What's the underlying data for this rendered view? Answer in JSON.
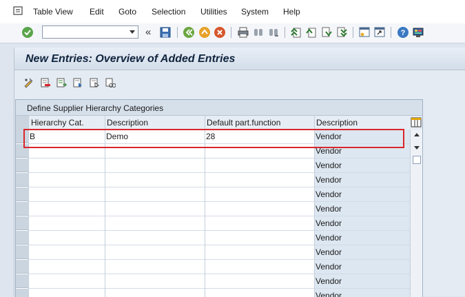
{
  "menu": {
    "items": [
      "Table View",
      "Edit",
      "Goto",
      "Selection",
      "Utilities",
      "System",
      "Help"
    ]
  },
  "toolbar": {
    "command_field": "",
    "icons": [
      "enter-icon",
      "back-chevron-icon",
      "save-icon",
      "back-icon",
      "exit-icon",
      "cancel-icon",
      "print-icon",
      "find-icon",
      "find-next-icon",
      "first-page-icon",
      "previous-page-icon",
      "next-page-icon",
      "last-page-icon",
      "create-session-icon",
      "shortcut-icon",
      "help-icon",
      "customize-layout-icon"
    ]
  },
  "screen": {
    "title": "New Entries: Overview of Added Entries"
  },
  "table": {
    "title": "Define Supplier Hierarchy Categories",
    "columns": [
      "Hierarchy Cat.",
      "Description",
      "Default part.function",
      "Description"
    ],
    "rows": [
      [
        "B",
        "Demo",
        "28",
        "Vendor"
      ],
      [
        "",
        "",
        "",
        "Vendor"
      ],
      [
        "",
        "",
        "",
        "Vendor"
      ],
      [
        "",
        "",
        "",
        "Vendor"
      ],
      [
        "",
        "",
        "",
        "Vendor"
      ],
      [
        "",
        "",
        "",
        "Vendor"
      ],
      [
        "",
        "",
        "",
        "Vendor"
      ],
      [
        "",
        "",
        "",
        "Vendor"
      ],
      [
        "",
        "",
        "",
        "Vendor"
      ],
      [
        "",
        "",
        "",
        "Vendor"
      ],
      [
        "",
        "",
        "",
        "Vendor"
      ],
      [
        "",
        "",
        "",
        "Vendor"
      ]
    ]
  },
  "colors": {
    "accent_highlight": "#d9262b",
    "title_text": "#10243e",
    "readonly_column": "#dde7f1"
  }
}
